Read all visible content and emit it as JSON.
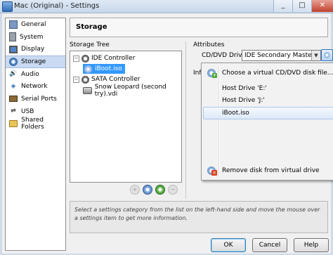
{
  "window": {
    "title": "Mac (Original) - Settings",
    "controls": [
      "_",
      "□",
      "✕"
    ]
  },
  "sidebar": {
    "items": [
      {
        "label": "General",
        "icon": "general-icon"
      },
      {
        "label": "System",
        "icon": "system-icon"
      },
      {
        "label": "Display",
        "icon": "display-icon"
      },
      {
        "label": "Storage",
        "icon": "storage-icon",
        "selected": true
      },
      {
        "label": "Audio",
        "icon": "audio-icon"
      },
      {
        "label": "Network",
        "icon": "network-icon"
      },
      {
        "label": "Serial Ports",
        "icon": "serial-ports-icon"
      },
      {
        "label": "USB",
        "icon": "usb-icon"
      },
      {
        "label": "Shared Folders",
        "icon": "shared-folders-icon"
      }
    ]
  },
  "page": {
    "title": "Storage",
    "storage_tree_label": "Storage Tree",
    "attributes_label": "Attributes",
    "info_cut": "Inf"
  },
  "tree": {
    "ide_controller": "IDE Controller",
    "iboot": "iBoot.iso",
    "sata_controller": "SATA Controller",
    "vdi": "Snow Leopard (second try).vdi",
    "expanders": [
      "−",
      "−"
    ]
  },
  "attributes": {
    "cd_drive_label": "CD/DVD Drive:",
    "cd_drive_value": "IDE Secondary Master",
    "dropdown_arrow": "▼"
  },
  "menu": {
    "items": [
      {
        "label": "Choose a virtual CD/DVD disk file..."
      },
      {
        "label": "Host Drive 'E:'"
      },
      {
        "label": "Host Drive 'J:'"
      },
      {
        "label": "iBoot.iso",
        "highlighted": true
      },
      {
        "label": "Remove disk from virtual drive"
      }
    ]
  },
  "description": "Select a settings category from the list on the left-hand side and move the mouse over a settings item to get more information.",
  "buttons": {
    "ok": "OK",
    "cancel": "Cancel",
    "help": "Help"
  },
  "colors": {
    "selection": "#3399ff",
    "sidebar_selection": "#c9daf2"
  }
}
